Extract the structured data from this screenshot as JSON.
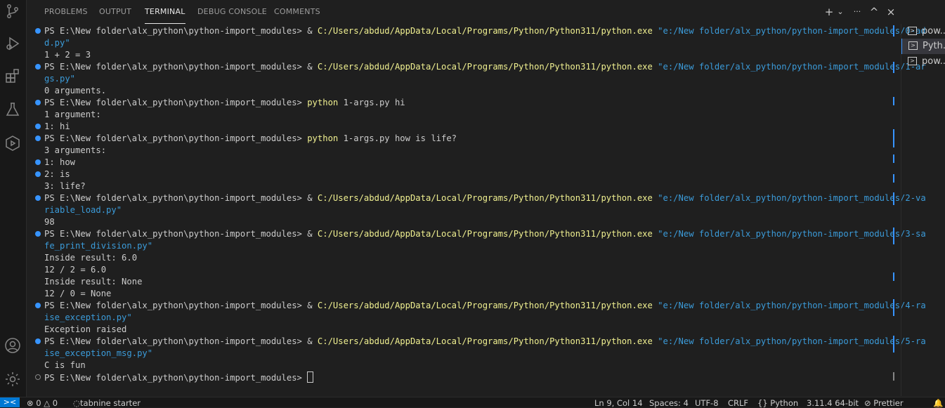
{
  "panel": {
    "tabs": [
      "PROBLEMS",
      "OUTPUT",
      "TERMINAL",
      "DEBUG CONSOLE",
      "COMMENTS"
    ],
    "active_tab": "TERMINAL",
    "actions": {
      "new": "+",
      "dropdown": "⌄",
      "more": "···",
      "maximize": "^",
      "close": "×"
    }
  },
  "terminal": {
    "lines": [
      {
        "segs": [
          {
            "t": "PS E:\\New folder\\alx_python\\python-import_modules> & "
          },
          {
            "t": "C:/Users/abdud/AppData/Local/Programs/Python/Python311/python.exe",
            "c": "y"
          },
          {
            "t": " "
          },
          {
            "t": "\"e:/New folder/alx_python/python-import_modules/0-ad",
            "c": "b"
          }
        ],
        "deco": "blue"
      },
      {
        "segs": [
          {
            "t": "d.py\"",
            "c": "b"
          }
        ]
      },
      {
        "segs": [
          {
            "t": "1 + 2 = 3"
          }
        ]
      },
      {
        "segs": [
          {
            "t": "PS E:\\New folder\\alx_python\\python-import_modules> & "
          },
          {
            "t": "C:/Users/abdud/AppData/Local/Programs/Python/Python311/python.exe",
            "c": "y"
          },
          {
            "t": " "
          },
          {
            "t": "\"e:/New folder/alx_python/python-import_modules/1-ar",
            "c": "b"
          }
        ],
        "deco": "blue"
      },
      {
        "segs": [
          {
            "t": "gs.py\"",
            "c": "b"
          }
        ]
      },
      {
        "segs": [
          {
            "t": "0 arguments."
          }
        ]
      },
      {
        "segs": [
          {
            "t": "PS E:\\New folder\\alx_python\\python-import_modules> "
          },
          {
            "t": "python",
            "c": "y"
          },
          {
            "t": " 1-args.py hi"
          }
        ],
        "deco": "blue"
      },
      {
        "segs": [
          {
            "t": "1 argument:"
          }
        ]
      },
      {
        "segs": [
          {
            "t": "1: hi"
          }
        ],
        "deco": "blue"
      },
      {
        "segs": [
          {
            "t": "PS E:\\New folder\\alx_python\\python-import_modules> "
          },
          {
            "t": "python",
            "c": "y"
          },
          {
            "t": " 1-args.py how is life?"
          }
        ],
        "deco": "blue"
      },
      {
        "segs": [
          {
            "t": "3 arguments:"
          }
        ]
      },
      {
        "segs": [
          {
            "t": "1: how"
          }
        ],
        "deco": "blue"
      },
      {
        "segs": [
          {
            "t": "2: is"
          }
        ],
        "deco": "blue"
      },
      {
        "segs": [
          {
            "t": "3: life?"
          }
        ]
      },
      {
        "segs": [
          {
            "t": "PS E:\\New folder\\alx_python\\python-import_modules> & "
          },
          {
            "t": "C:/Users/abdud/AppData/Local/Programs/Python/Python311/python.exe",
            "c": "y"
          },
          {
            "t": " "
          },
          {
            "t": "\"e:/New folder/alx_python/python-import_modules/2-va",
            "c": "b"
          }
        ],
        "deco": "blue"
      },
      {
        "segs": [
          {
            "t": "riable_load.py\"",
            "c": "b"
          }
        ]
      },
      {
        "segs": [
          {
            "t": "98"
          }
        ]
      },
      {
        "segs": [
          {
            "t": "PS E:\\New folder\\alx_python\\python-import_modules> & "
          },
          {
            "t": "C:/Users/abdud/AppData/Local/Programs/Python/Python311/python.exe",
            "c": "y"
          },
          {
            "t": " "
          },
          {
            "t": "\"e:/New folder/alx_python/python-import_modules/3-sa",
            "c": "b"
          }
        ],
        "deco": "blue"
      },
      {
        "segs": [
          {
            "t": "fe_print_division.py\"",
            "c": "b"
          }
        ]
      },
      {
        "segs": [
          {
            "t": "Inside result: 6.0"
          }
        ]
      },
      {
        "segs": [
          {
            "t": "12 / 2 = 6.0"
          }
        ]
      },
      {
        "segs": [
          {
            "t": "Inside result: None"
          }
        ]
      },
      {
        "segs": [
          {
            "t": "12 / 0 = None"
          }
        ]
      },
      {
        "segs": [
          {
            "t": "PS E:\\New folder\\alx_python\\python-import_modules> & "
          },
          {
            "t": "C:/Users/abdud/AppData/Local/Programs/Python/Python311/python.exe",
            "c": "y"
          },
          {
            "t": " "
          },
          {
            "t": "\"e:/New folder/alx_python/python-import_modules/4-ra",
            "c": "b"
          }
        ],
        "deco": "blue"
      },
      {
        "segs": [
          {
            "t": "ise_exception.py\"",
            "c": "b"
          }
        ]
      },
      {
        "segs": [
          {
            "t": "Exception raised"
          }
        ]
      },
      {
        "segs": [
          {
            "t": "PS E:\\New folder\\alx_python\\python-import_modules> & "
          },
          {
            "t": "C:/Users/abdud/AppData/Local/Programs/Python/Python311/python.exe",
            "c": "y"
          },
          {
            "t": " "
          },
          {
            "t": "\"e:/New folder/alx_python/python-import_modules/5-ra",
            "c": "b"
          }
        ],
        "deco": "blue"
      },
      {
        "segs": [
          {
            "t": "ise_exception_msg.py\"",
            "c": "b"
          }
        ]
      },
      {
        "segs": [
          {
            "t": "C is fun"
          }
        ]
      },
      {
        "segs": [
          {
            "t": "PS E:\\New folder\\alx_python\\python-import_modules> "
          }
        ],
        "deco": "hollow",
        "cursor": true
      }
    ]
  },
  "terminal_list": [
    {
      "label": "pow...",
      "selected": false
    },
    {
      "label": "Pyth...",
      "selected": true
    },
    {
      "label": "pow...",
      "selected": false
    }
  ],
  "status": {
    "errors": "0",
    "warnings": "0",
    "tabnine": "tabnine starter",
    "position": "Ln 9, Col 14",
    "spaces": "Spaces: 4",
    "encoding": "UTF-8",
    "eol": "CRLF",
    "language": "Python",
    "interpreter": "3.11.4 64-bit",
    "prettier": "Prettier"
  },
  "colors": {
    "accent": "#0078d4",
    "prompt_cmd": "#f0f090",
    "string": "#3b9bd9",
    "decoration": "#3794ff"
  }
}
